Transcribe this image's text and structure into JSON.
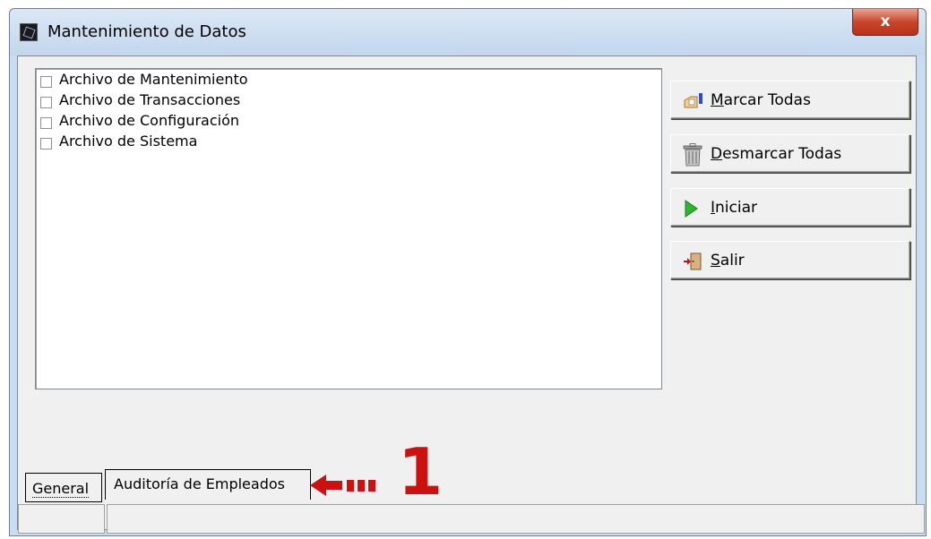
{
  "window": {
    "title": "Mantenimiento de Datos",
    "close_label": "x"
  },
  "list": {
    "items": [
      {
        "label": "Archivo de Mantenimiento",
        "checked": false
      },
      {
        "label": "Archivo de Transacciones",
        "checked": false
      },
      {
        "label": "Archivo de Configuración",
        "checked": false
      },
      {
        "label": "Archivo de Sistema",
        "checked": false
      }
    ]
  },
  "buttons": {
    "marcar": {
      "accel": "M",
      "rest": "arcar Todas",
      "icon": "mark-all-icon"
    },
    "desmarcar": {
      "accel": "D",
      "rest": "esmarcar Todas",
      "icon": "trash-icon"
    },
    "iniciar": {
      "accel": "I",
      "rest": "niciar",
      "icon": "play-icon"
    },
    "salir": {
      "accel": "S",
      "rest": "alir",
      "icon": "exit-door-icon"
    }
  },
  "tabs": [
    {
      "label": "General"
    },
    {
      "label": "Auditoría de Empleados"
    }
  ],
  "annotation": {
    "number": "1",
    "color": "#cc1111"
  }
}
